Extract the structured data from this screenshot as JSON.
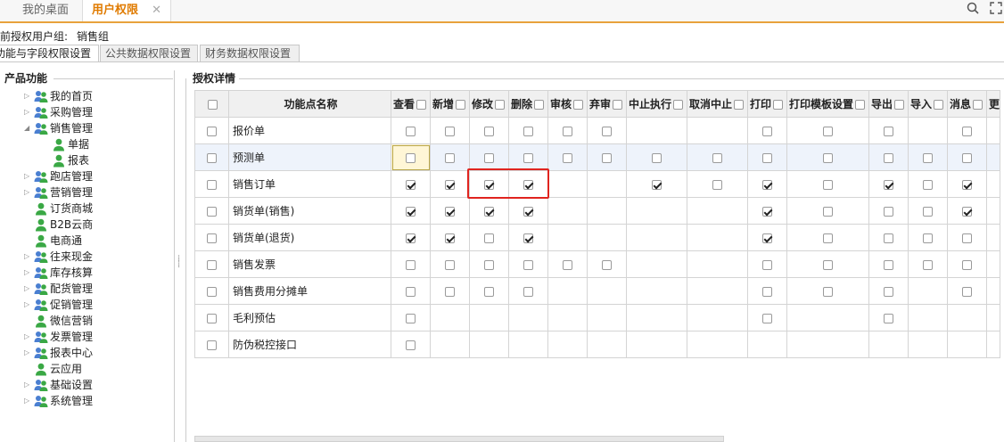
{
  "tabs": [
    {
      "label": "我的桌面"
    },
    {
      "label": "用户权限",
      "close": "✕"
    }
  ],
  "group": {
    "label": "前授权用户组:",
    "value": "销售组"
  },
  "subtabs": [
    "功能与字段权限设置",
    "公共数据权限设置",
    "财务数据权限设置"
  ],
  "left_title": "产品功能",
  "tree": [
    {
      "label": "我的首页",
      "expandable": true,
      "indent": 0
    },
    {
      "label": "采购管理",
      "expandable": true,
      "indent": 0
    },
    {
      "label": "销售管理",
      "expandable": true,
      "expanded": true,
      "indent": 0
    },
    {
      "label": "单据",
      "expandable": false,
      "indent": 1
    },
    {
      "label": "报表",
      "expandable": false,
      "indent": 1
    },
    {
      "label": "跑店管理",
      "expandable": true,
      "indent": 0
    },
    {
      "label": "营销管理",
      "expandable": true,
      "indent": 0
    },
    {
      "label": "订货商城",
      "expandable": false,
      "indent": 0
    },
    {
      "label": "B2B云商",
      "expandable": false,
      "indent": 0
    },
    {
      "label": "电商通",
      "expandable": false,
      "indent": 0
    },
    {
      "label": "往来现金",
      "expandable": true,
      "indent": 0
    },
    {
      "label": "库存核算",
      "expandable": true,
      "indent": 0
    },
    {
      "label": "配货管理",
      "expandable": true,
      "indent": 0
    },
    {
      "label": "促销管理",
      "expandable": true,
      "indent": 0
    },
    {
      "label": "微信营销",
      "expandable": false,
      "indent": 0
    },
    {
      "label": "发票管理",
      "expandable": true,
      "indent": 0
    },
    {
      "label": "报表中心",
      "expandable": true,
      "indent": 0
    },
    {
      "label": "云应用",
      "expandable": false,
      "indent": 0
    },
    {
      "label": "基础设置",
      "expandable": true,
      "indent": 0
    },
    {
      "label": "系统管理",
      "expandable": true,
      "indent": 0
    }
  ],
  "right_title": "授权详情",
  "grid": {
    "name_header": "功能点名称",
    "columns": [
      "查看",
      "新增",
      "修改",
      "删除",
      "审核",
      "弃审",
      "中止执行",
      "取消中止",
      "打印",
      "打印模板设置",
      "导出",
      "导入",
      "消息",
      "更"
    ],
    "rows": [
      {
        "name": "报价单",
        "cells": [
          0,
          0,
          0,
          0,
          0,
          0,
          null,
          null,
          0,
          0,
          0,
          null,
          0,
          null
        ]
      },
      {
        "name": "预测单",
        "cells": [
          0,
          0,
          0,
          0,
          0,
          0,
          0,
          0,
          0,
          0,
          0,
          0,
          0,
          null
        ]
      },
      {
        "name": "销售订单",
        "cells": [
          1,
          1,
          1,
          1,
          null,
          null,
          1,
          0,
          1,
          0,
          1,
          0,
          1,
          null
        ]
      },
      {
        "name": "销货单(销售)",
        "cells": [
          1,
          1,
          1,
          1,
          null,
          null,
          null,
          null,
          1,
          0,
          0,
          0,
          1,
          null
        ]
      },
      {
        "name": "销货单(退货)",
        "cells": [
          1,
          1,
          0,
          1,
          null,
          null,
          null,
          null,
          1,
          0,
          0,
          0,
          0,
          null
        ]
      },
      {
        "name": "销售发票",
        "cells": [
          0,
          0,
          0,
          0,
          0,
          0,
          null,
          null,
          0,
          0,
          0,
          0,
          0,
          null
        ]
      },
      {
        "name": "销售费用分摊单",
        "cells": [
          0,
          0,
          0,
          0,
          null,
          null,
          null,
          null,
          0,
          0,
          0,
          null,
          0,
          null
        ]
      },
      {
        "name": "毛利预估",
        "cells": [
          0,
          null,
          null,
          null,
          null,
          null,
          null,
          null,
          0,
          null,
          0,
          null,
          null,
          null
        ]
      },
      {
        "name": "防伪税控接口",
        "cells": [
          0,
          null,
          null,
          null,
          null,
          null,
          null,
          null,
          null,
          null,
          null,
          null,
          null,
          null
        ]
      }
    ]
  },
  "colors": {
    "accent": "#e8a23c",
    "annotation": "#e0241f"
  }
}
